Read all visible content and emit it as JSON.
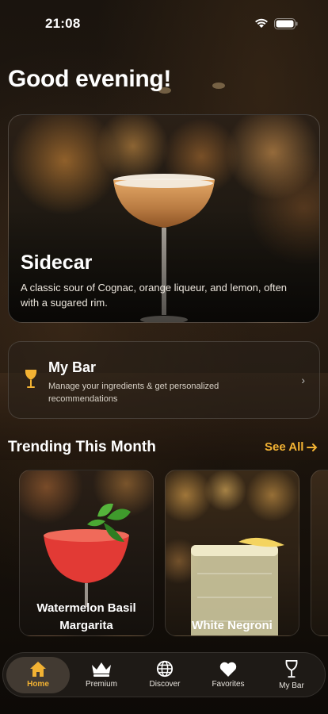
{
  "status_bar": {
    "time": "21:08"
  },
  "greeting": "Good evening!",
  "featured": {
    "title": "Sidecar",
    "description": "A classic sour of Cognac, orange liqueur, and lemon, often with a sugared rim."
  },
  "my_bar": {
    "title": "My Bar",
    "subtitle": "Manage your ingredients & get personalized recommendations"
  },
  "trending": {
    "heading": "Trending This Month",
    "see_all": "See All",
    "items": [
      {
        "name": "Watermelon Basil Margarita"
      },
      {
        "name": "White Negroni"
      }
    ]
  },
  "tabs": [
    {
      "label": "Home",
      "icon": "home-icon",
      "active": true
    },
    {
      "label": "Premium",
      "icon": "crown-icon",
      "active": false
    },
    {
      "label": "Discover",
      "icon": "globe-icon",
      "active": false
    },
    {
      "label": "Favorites",
      "icon": "heart-icon",
      "active": false
    },
    {
      "label": "My Bar",
      "icon": "wine-glass-icon",
      "active": false
    }
  ],
  "colors": {
    "accent": "#f2b233",
    "background": "#1a140e"
  }
}
